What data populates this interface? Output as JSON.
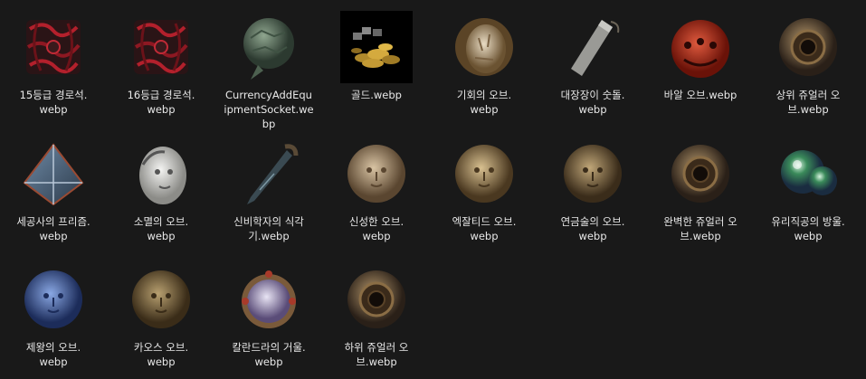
{
  "files": [
    {
      "name": "15등급 경로석.webp",
      "line1": "15등급 경로석.",
      "line2": "webp",
      "icon": "red-tendril-waystone-icon"
    },
    {
      "name": "16등급 경로석.webp",
      "line1": "16등급 경로석.",
      "line2": "webp",
      "icon": "red-tendril-waystone-icon"
    },
    {
      "name": "CurrencyAddEquipmentSocket.webp",
      "line1": "CurrencyAddEqu",
      "line2": "ipmentSocket.we",
      "line3": "bp",
      "icon": "green-stone-sphere-icon"
    },
    {
      "name": "골드.webp",
      "line1": "골드.webp",
      "line2": "",
      "icon": "gold-coin-pile-icon"
    },
    {
      "name": "기회의 오브.webp",
      "line1": "기회의 오브.",
      "line2": "webp",
      "icon": "chance-orb-icon"
    },
    {
      "name": "대장장이 숫돌.webp",
      "line1": "대장장이 숫돌.",
      "line2": "webp",
      "icon": "whetstone-icon"
    },
    {
      "name": "바알 오브.webp",
      "line1": "바알 오브.webp",
      "line2": "",
      "icon": "vaal-orb-icon"
    },
    {
      "name": "상위 쥬얼러 오브.webp",
      "line1": "상위 쥬얼러 오",
      "line2": "브.webp",
      "icon": "greater-jeweller-orb-icon"
    },
    {
      "name": "세공사의 프리즘.webp",
      "line1": "세공사의 프리즘.",
      "line2": "webp",
      "icon": "gemcutter-prism-icon"
    },
    {
      "name": "소멸의 오브.webp",
      "line1": "소멸의 오브.",
      "line2": "webp",
      "icon": "annulment-orb-icon"
    },
    {
      "name": "신비학자의 식각기.webp",
      "line1": "신비학자의 식각",
      "line2": "기.webp",
      "icon": "arcanist-etcher-icon"
    },
    {
      "name": "신성한 오브.webp",
      "line1": "신성한 오브.",
      "line2": "webp",
      "icon": "divine-orb-icon"
    },
    {
      "name": "엑잘티드 오브.webp",
      "line1": "엑잘티드 오브.",
      "line2": "webp",
      "icon": "exalted-orb-icon"
    },
    {
      "name": "연금술의 오브.webp",
      "line1": "연금술의 오브.",
      "line2": "webp",
      "icon": "alchemy-orb-icon"
    },
    {
      "name": "완벽한 쥬얼러 오브.webp",
      "line1": "완벽한 쥬얼러 오",
      "line2": "브.webp",
      "icon": "perfect-jeweller-orb-icon"
    },
    {
      "name": "유리직공의 방울.webp",
      "line1": "유리직공의 방울.",
      "line2": "webp",
      "icon": "glassblower-bauble-icon"
    },
    {
      "name": "제왕의 오브.webp",
      "line1": "제왕의 오브.",
      "line2": "webp",
      "icon": "regal-orb-icon"
    },
    {
      "name": "카오스 오브.webp",
      "line1": "카오스 오브.",
      "line2": "webp",
      "icon": "chaos-orb-icon"
    },
    {
      "name": "칼란드라의 거울.webp",
      "line1": "칼란드라의 거울.",
      "line2": "webp",
      "icon": "mirror-of-kalandra-icon"
    },
    {
      "name": "하위 쥬얼러 오브.webp",
      "line1": "하위 쥬얼러 오",
      "line2": "브.webp",
      "icon": "lesser-jeweller-orb-icon"
    }
  ],
  "colors": {
    "background": "#191919",
    "text": "#e8e8e8"
  }
}
